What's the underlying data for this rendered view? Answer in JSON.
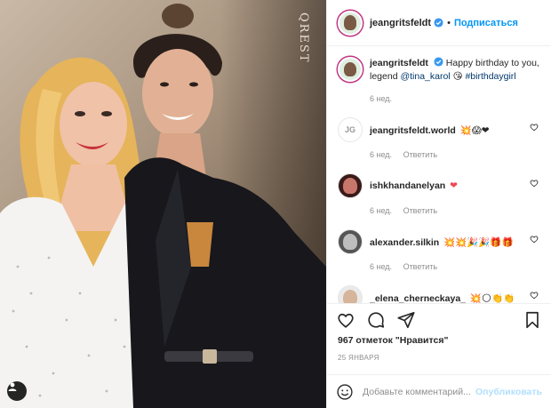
{
  "post": {
    "author": "jeangritsfeldt",
    "follow_label": "Подписаться",
    "dot": "•",
    "more_label": "...",
    "photo_watermark": "QREST",
    "caption": {
      "username": "jeangritsfeldt",
      "text": "Happy birthday to you, legend",
      "mention": "@tina_karol",
      "emoji": "😘",
      "hashtag": "#birthdaygirl",
      "age": "6 нед."
    },
    "comments": [
      {
        "username": "jeangritsfeldt.world",
        "emoji": "💥😱❤",
        "age": "6 нед.",
        "reply": "Ответить"
      },
      {
        "username": "ishkhandanelyan",
        "emoji": "❤",
        "age": "6 нед.",
        "reply": "Ответить"
      },
      {
        "username": "alexander.silkin",
        "emoji": "💥💥🎉🎉🎁🎁",
        "age": "6 нед.",
        "reply": "Ответить"
      },
      {
        "username": "_elena_cherneckaya_",
        "emoji": "💥🌕👏👏",
        "age": "",
        "reply": ""
      }
    ],
    "avatars": {
      "jg_world": "JG"
    },
    "likes": "967 отметок \"Нравится\"",
    "date": "25 ЯНВАРЯ",
    "comment_placeholder": "Добавьте комментарий...",
    "publish_label": "Опубликовать"
  },
  "colors": {
    "link": "#0095f6",
    "mention": "#00376b",
    "heart": "#ed4956",
    "muted": "#8e8e8e"
  }
}
